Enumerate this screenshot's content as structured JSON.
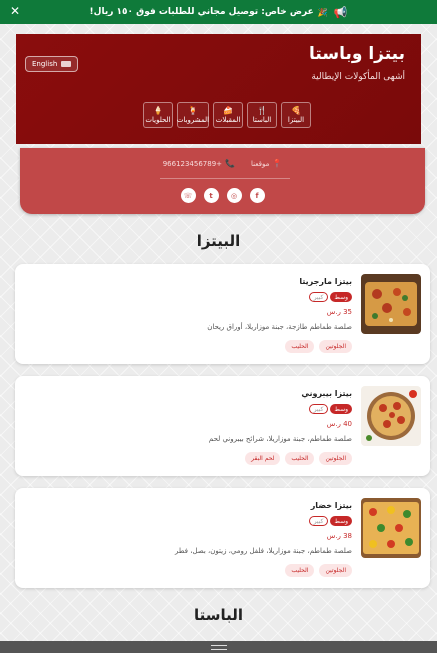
{
  "promo": {
    "text": "عرض خاص: توصيل مجاني للطلبات فوق ١٥٠ ريال!",
    "spark": "🎉",
    "close": "✕"
  },
  "header": {
    "title": "بيتزا وباستا",
    "subtitle": "أشهى المأكولات الإيطالية",
    "lang_button": "English",
    "categories": [
      {
        "icon": "🍕",
        "label": "البيتزا"
      },
      {
        "icon": "🍴",
        "label": "الباستا"
      },
      {
        "icon": "🍰",
        "label": "المقبلات"
      },
      {
        "icon": "🍹",
        "label": "المشروبات"
      },
      {
        "icon": "🍦",
        "label": "الحلويات"
      }
    ]
  },
  "contact": {
    "phone": "+966123456789",
    "location": "موقعنا",
    "socials": [
      "f",
      "◎",
      "t",
      "☏"
    ]
  },
  "sections": [
    {
      "title": "البيتزا"
    },
    {
      "title": "الباستا"
    }
  ],
  "products": [
    {
      "name": "بيتزا مارجريتا",
      "sizes": [
        "وسط",
        "كبير"
      ],
      "price": "35 ر.س",
      "desc": "صلصة طماطم طازجة، جبنة موزاريلا، أوراق ريحان",
      "tags": [
        "الجلوتين",
        "الحليب"
      ]
    },
    {
      "name": "بيتزا بيبروني",
      "sizes": [
        "وسط",
        "كبير"
      ],
      "price": "40 ر.س",
      "desc": "صلصة طماطم، جبنة موزاريلا، شرائح بيبروني لحم",
      "tags": [
        "الجلوتين",
        "الحليب",
        "لحم البقر"
      ]
    },
    {
      "name": "بيتزا خضار",
      "sizes": [
        "وسط",
        "كبير"
      ],
      "price": "38 ر.س",
      "desc": "صلصة طماطم، جبنة موزاريلا، فلفل رومي، زيتون، بصل، فطر",
      "tags": [
        "الجلوتين",
        "الحليب"
      ]
    }
  ],
  "colors": {
    "primary": "#8a0d0d",
    "accent": "#c62828",
    "promo": "#0f7a3a",
    "contact": "#c14848"
  }
}
